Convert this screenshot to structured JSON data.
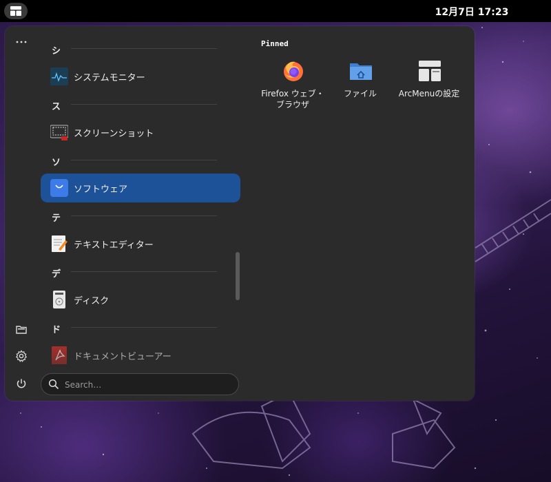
{
  "topbar": {
    "clock": "12月7日  17:23"
  },
  "sidebar": {
    "more_icon": "more-icon",
    "files_icon": "folder-icon",
    "settings_icon": "gear-icon",
    "power_icon": "power-icon"
  },
  "app_list": {
    "sections": [
      {
        "letter": "シ",
        "apps": [
          {
            "label": "システムモニター",
            "icon": "system-monitor-icon"
          }
        ]
      },
      {
        "letter": "ス",
        "apps": [
          {
            "label": "スクリーンショット",
            "icon": "screenshot-icon"
          }
        ]
      },
      {
        "letter": "ソ",
        "apps": [
          {
            "label": "ソフトウェア",
            "icon": "software-icon",
            "selected": true
          }
        ]
      },
      {
        "letter": "テ",
        "apps": [
          {
            "label": "テキストエディター",
            "icon": "text-editor-icon"
          }
        ]
      },
      {
        "letter": "デ",
        "apps": [
          {
            "label": "ディスク",
            "icon": "disks-icon"
          }
        ]
      },
      {
        "letter": "ド",
        "apps": [
          {
            "label": "ドキュメントビューアー",
            "icon": "document-viewer-icon"
          }
        ]
      }
    ]
  },
  "search": {
    "placeholder": "Search…",
    "value": ""
  },
  "pinned": {
    "title": "Pinned",
    "items": [
      {
        "label": "Firefox ウェブ・ブラウザ",
        "icon": "firefox-icon"
      },
      {
        "label": "ファイル",
        "icon": "files-folder-icon"
      },
      {
        "label": "ArcMenuの設定",
        "icon": "arcmenu-settings-icon"
      }
    ]
  },
  "colors": {
    "menu_bg": "#2b2b2b",
    "selected": "#1d5299",
    "panel": "#000000"
  }
}
